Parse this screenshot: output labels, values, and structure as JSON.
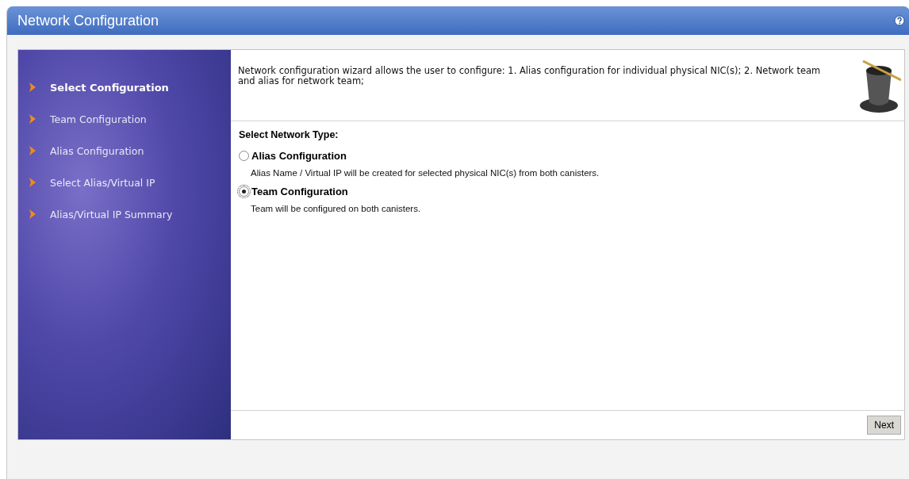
{
  "window": {
    "title": "Network Configuration"
  },
  "steps": [
    {
      "label": "Select Configuration",
      "selected": true
    },
    {
      "label": "Team Configuration",
      "selected": false
    },
    {
      "label": "Alias Configuration",
      "selected": false
    },
    {
      "label": "Select Alias/Virtual IP",
      "selected": false
    },
    {
      "label": "Alias/Virtual IP Summary",
      "selected": false
    }
  ],
  "description": "Network configuration wizard allows the user to configure: 1. Alias configuration for individual physical NIC(s); 2. Network team and alias for network team;",
  "section_title": "Select Network Type:",
  "options": [
    {
      "label": "Alias Configuration",
      "hint": "Alias Name / Virtual IP will be created for selected physical NIC(s) from both canisters.",
      "selected": false
    },
    {
      "label": "Team Configuration",
      "hint": "Team will be configured on both canisters.",
      "selected": true
    }
  ],
  "buttons": [
    "Next"
  ]
}
